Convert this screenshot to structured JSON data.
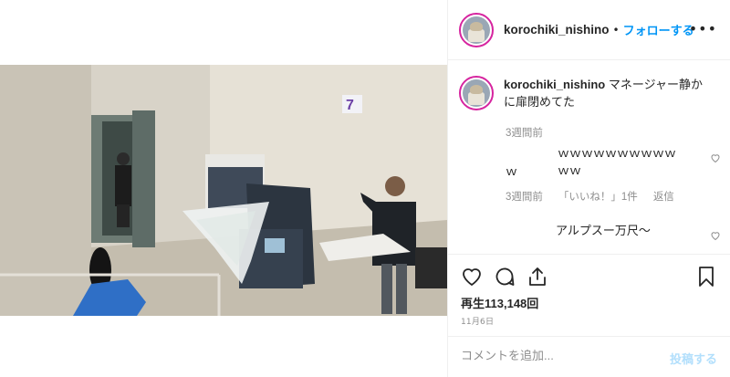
{
  "post": {
    "username": "korochiki_nishino",
    "separator": "•",
    "follow_label": "フォローする",
    "more_icon": "more-horizontal-icon",
    "video_badge_text": "7"
  },
  "caption": {
    "username": "korochiki_nishino",
    "text": "マネージャー静かに扉閉めてた",
    "time": "3週間前"
  },
  "comments": [
    {
      "text_line1": "ｗｗｗｗｗｗｗｗｗｗｗｗ",
      "text_line2": "ｗ",
      "time": "3週間前",
      "likes": "「いいね！」1件",
      "reply": "返信"
    },
    {
      "text": "アルプスー万尺〜"
    }
  ],
  "actions": {
    "like_icon": "heart-icon",
    "comment_icon": "comment-icon",
    "share_icon": "share-icon",
    "save_icon": "bookmark-icon"
  },
  "stats": {
    "views": "再生113,148回",
    "date": "11月6日"
  },
  "add_comment": {
    "placeholder": "コメントを追加...",
    "post_label": "投稿する"
  },
  "colors": {
    "accent": "#0095f6",
    "muted": "#8e8e8e",
    "post_disabled": "#b2dffc"
  }
}
